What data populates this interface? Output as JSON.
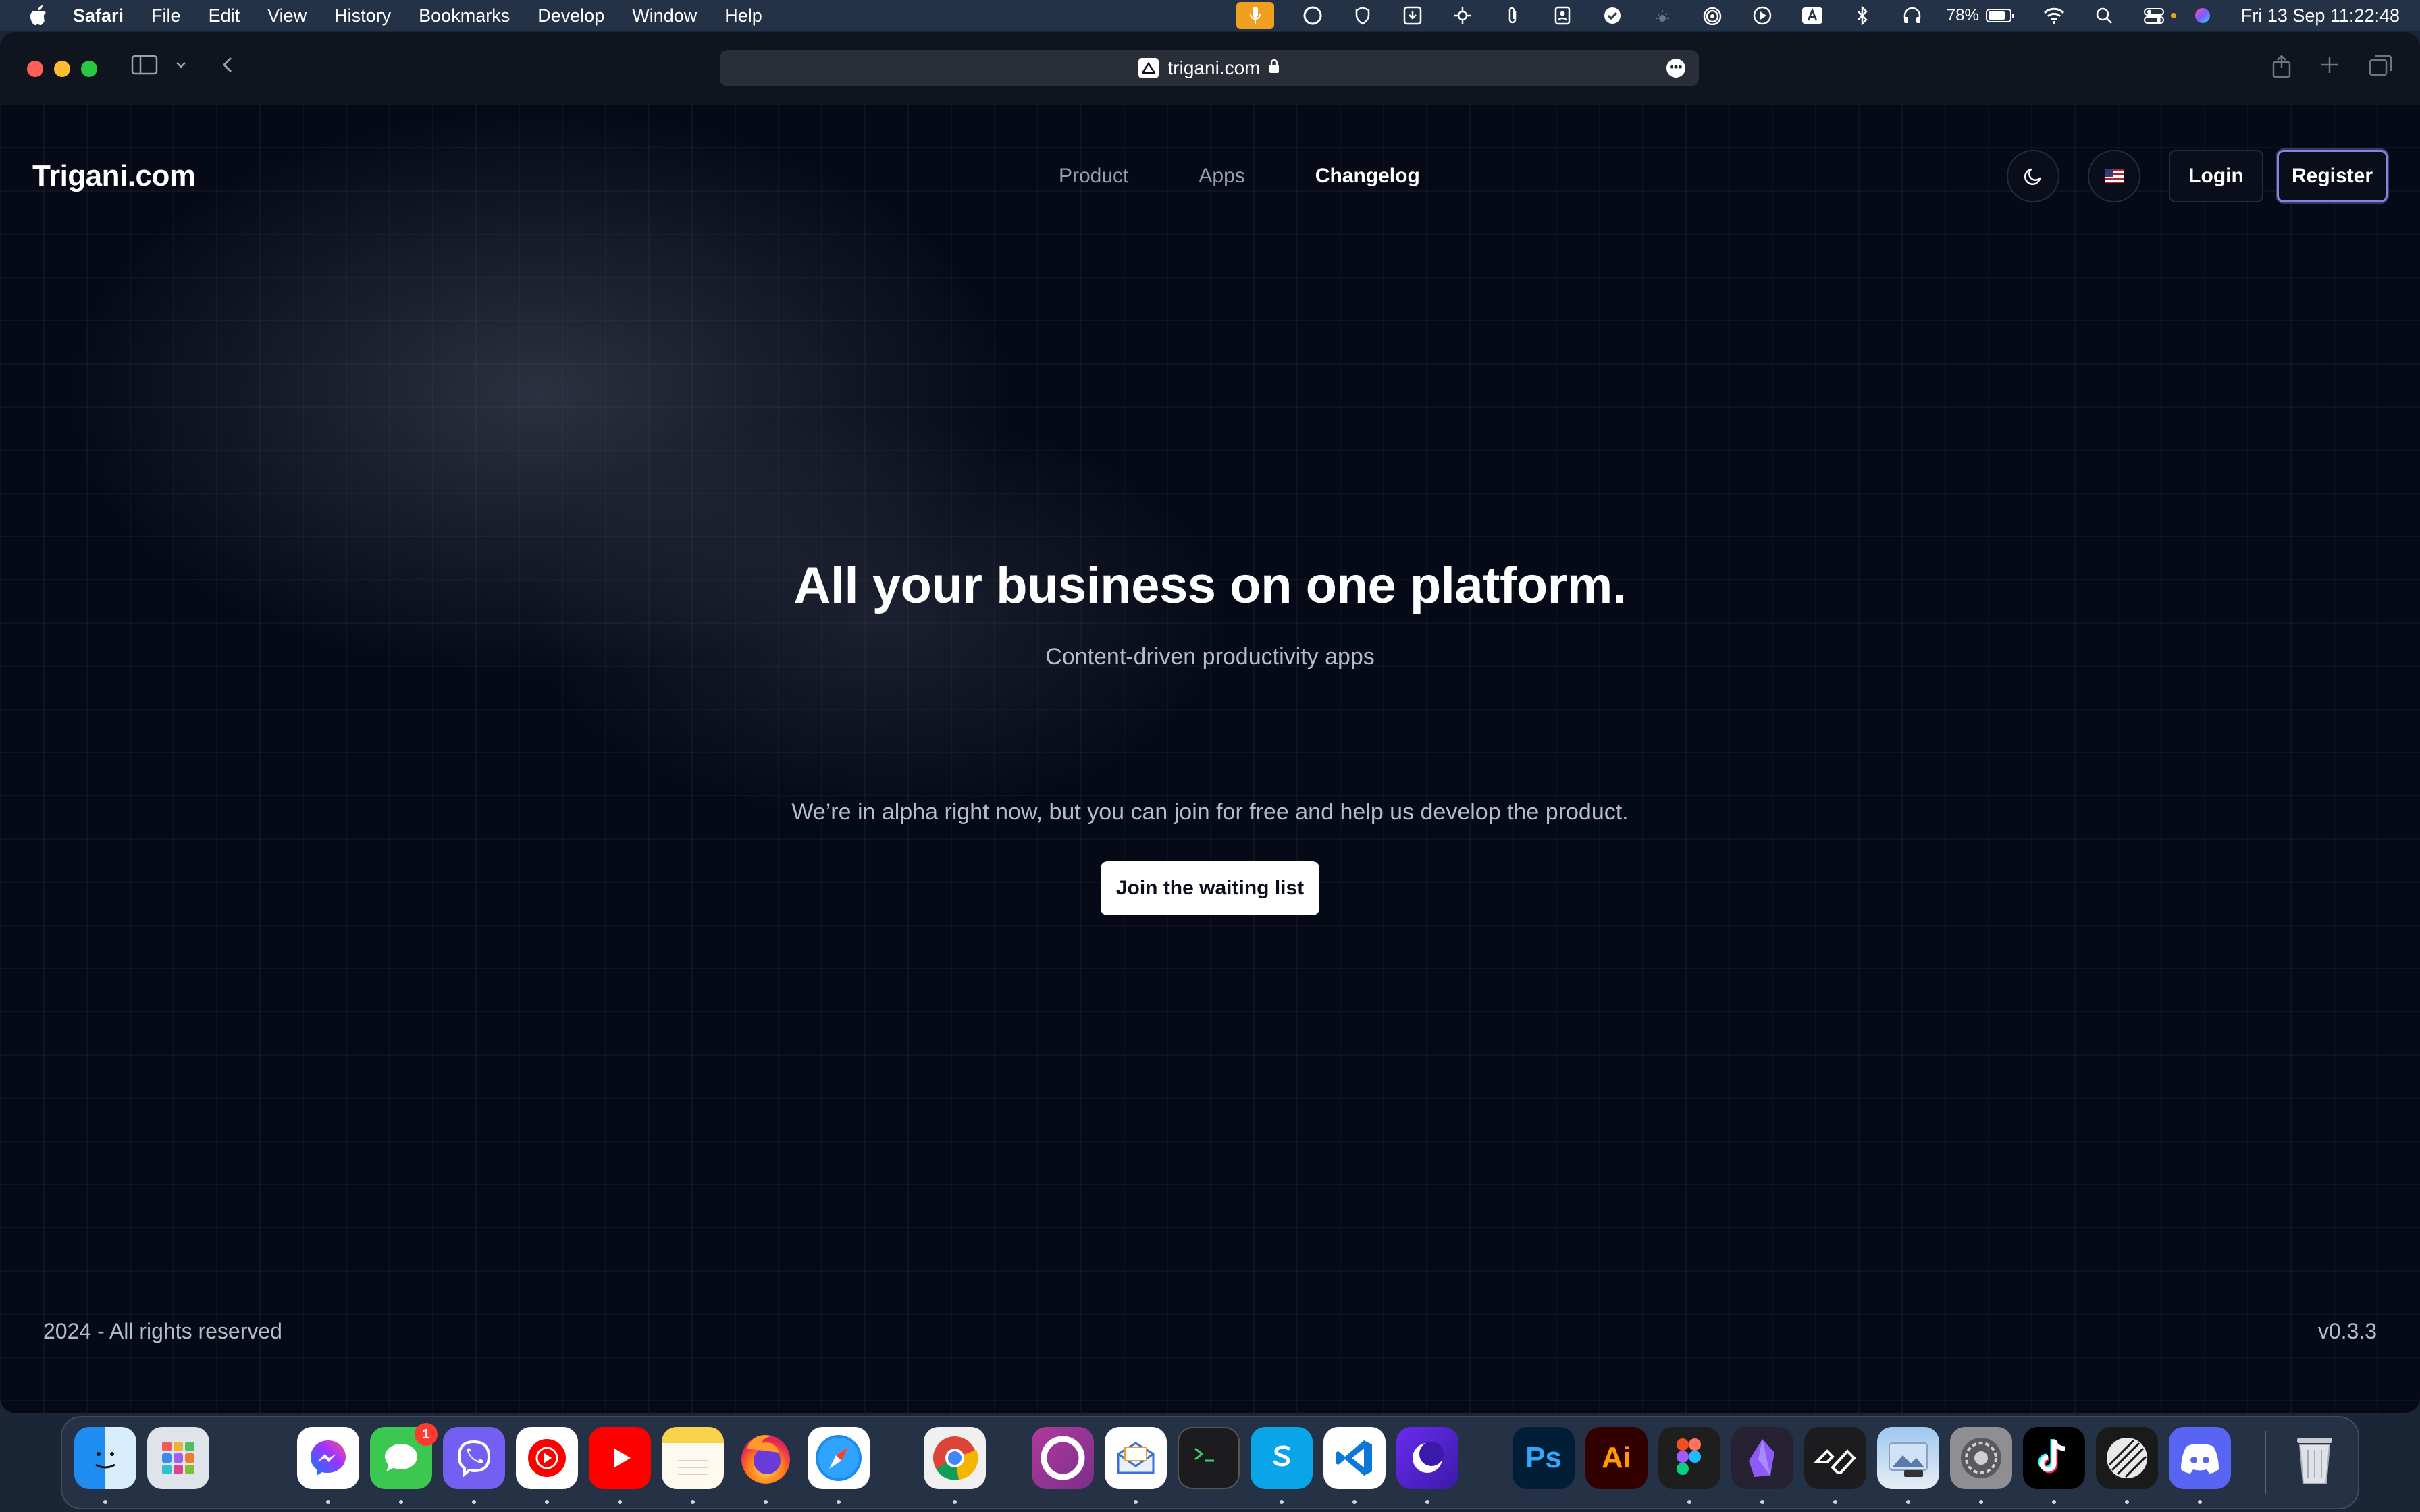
{
  "menubar": {
    "app_name": "Safari",
    "items": [
      "File",
      "Edit",
      "View",
      "History",
      "Bookmarks",
      "Develop",
      "Window",
      "Help"
    ],
    "battery": "78%",
    "clock": "Fri 13 Sep  11:22:48"
  },
  "browser": {
    "url": "trigani.com"
  },
  "site": {
    "logo": "Trigani.com",
    "nav": [
      "Product",
      "Apps",
      "Changelog"
    ],
    "login_label": "Login",
    "register_label": "Register",
    "hero_title": "All your business on one platform.",
    "hero_subtitle": "Content-driven productivity apps",
    "alpha_text": "We’re in alpha right now, but you can join for free and help us develop the product.",
    "join_label": "Join the waiting list",
    "footer_left": "2024 - All rights reserved",
    "footer_right": "v0.3.3"
  },
  "dock": {
    "messages_badge": "1",
    "ps_label": "Ps",
    "ai_label": "Ai"
  }
}
